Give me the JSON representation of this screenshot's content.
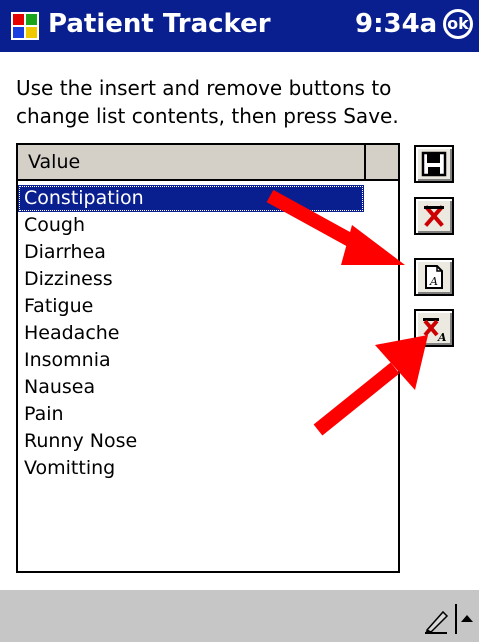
{
  "titlebar": {
    "app_icon": "windows-flag-icon",
    "title": "Patient Tracker",
    "time": "9:34a",
    "ok_label": "ok"
  },
  "instructions": "Use the insert and remove buttons to change list contents, then press Save.",
  "list": {
    "header": "Value",
    "items": [
      "Constipation",
      "Cough",
      "Diarrhea",
      "Dizziness",
      "Fatigue",
      "Headache",
      "Insomnia",
      "Nausea",
      "Pain",
      "Runny Nose",
      "Vomitting"
    ],
    "selected_index": 0
  },
  "buttons": [
    {
      "name": "save-button",
      "icon": "floppy-disk-icon"
    },
    {
      "name": "delete-button",
      "icon": "red-x-icon"
    },
    {
      "name": "insert-button",
      "icon": "new-document-icon"
    },
    {
      "name": "remove-button",
      "icon": "red-x-document-icon"
    }
  ],
  "taskbar": {
    "input_icon": "pen-icon",
    "sip_toggle_icon": "up-arrow-icon"
  },
  "colors": {
    "titlebar_bg": "#0a1f8f",
    "selection_bg": "#0a1f8f",
    "annotation_arrow": "#ff0000",
    "taskbar_bg": "#c6c6c6"
  }
}
